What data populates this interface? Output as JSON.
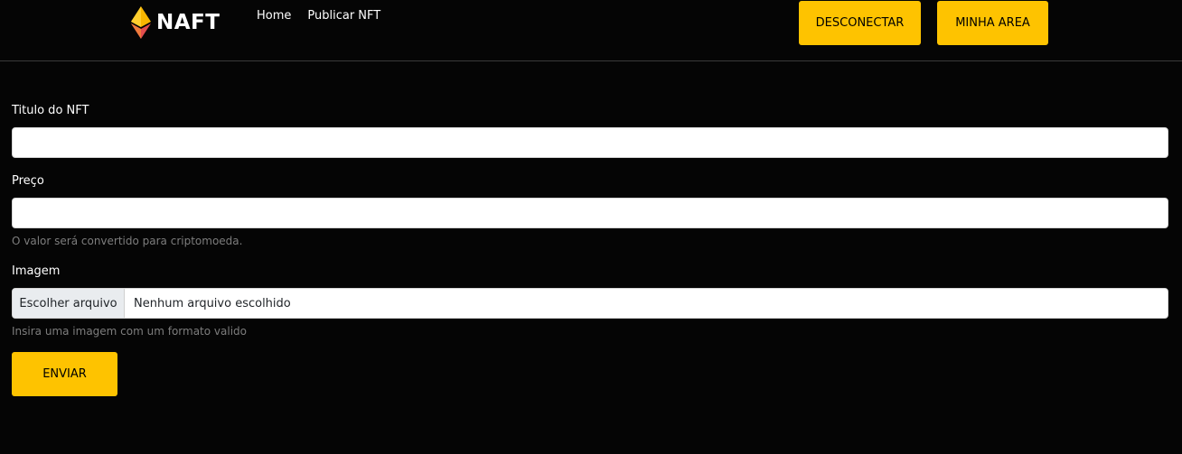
{
  "navbar": {
    "brand": "NAFT",
    "links": [
      "Home",
      "Publicar NFT"
    ],
    "disconnect_label": "DESCONECTAR",
    "area_label": "MINHA AREA"
  },
  "form": {
    "title_label": "Titulo do NFT",
    "title_value": "",
    "price_label": "Preço",
    "price_value": "",
    "price_help": "O valor será convertido para criptomoeda.",
    "image_label": "Imagem",
    "file_button": "Escolher arquivo",
    "file_status": "Nenhum arquivo escolhido",
    "image_help": "Insira uma imagem com um formato valido",
    "submit_label": "ENVIAR"
  },
  "colors": {
    "background": "#050505",
    "accent": "#fec300",
    "logo_top": "#f7b500",
    "logo_bottom": "#e24d4d"
  },
  "icons": {
    "logo": "ethereum-diamond-icon"
  }
}
